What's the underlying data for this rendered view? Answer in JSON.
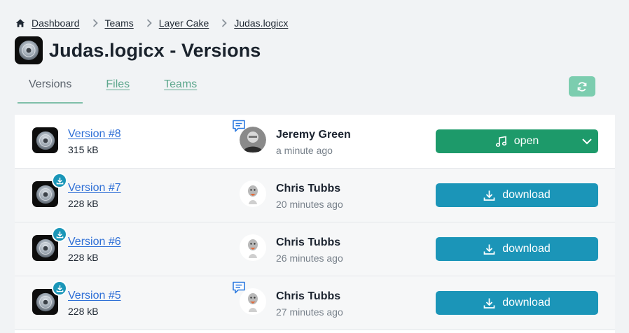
{
  "breadcrumb": [
    {
      "label": "Dashboard"
    },
    {
      "label": "Teams"
    },
    {
      "label": "Layer Cake"
    },
    {
      "label": "Judas.logicx"
    }
  ],
  "page": {
    "title": "Judas.logicx - Versions"
  },
  "tabs": [
    {
      "label": "Versions",
      "active": true
    },
    {
      "label": "Files",
      "active": false
    },
    {
      "label": "Teams",
      "active": false
    }
  ],
  "colors": {
    "accent": "#1d9a6a",
    "download": "#1b95b8",
    "link": "#2e6fd6",
    "refresh": "#7ccdaf"
  },
  "versions": [
    {
      "label": "Version #8",
      "size": "315 kB",
      "user": "Jeremy Green",
      "time": "a minute ago",
      "action": "open",
      "has_comment": true,
      "downloaded": false
    },
    {
      "label": "Version #7",
      "size": "228 kB",
      "user": "Chris Tubbs",
      "time": "20 minutes ago",
      "action": "download",
      "has_comment": false,
      "downloaded": true
    },
    {
      "label": "Version #6",
      "size": "228 kB",
      "user": "Chris Tubbs",
      "time": "26 minutes ago",
      "action": "download",
      "has_comment": false,
      "downloaded": true
    },
    {
      "label": "Version #5",
      "size": "228 kB",
      "user": "Chris Tubbs",
      "time": "27 minutes ago",
      "action": "download",
      "has_comment": true,
      "downloaded": true
    }
  ]
}
